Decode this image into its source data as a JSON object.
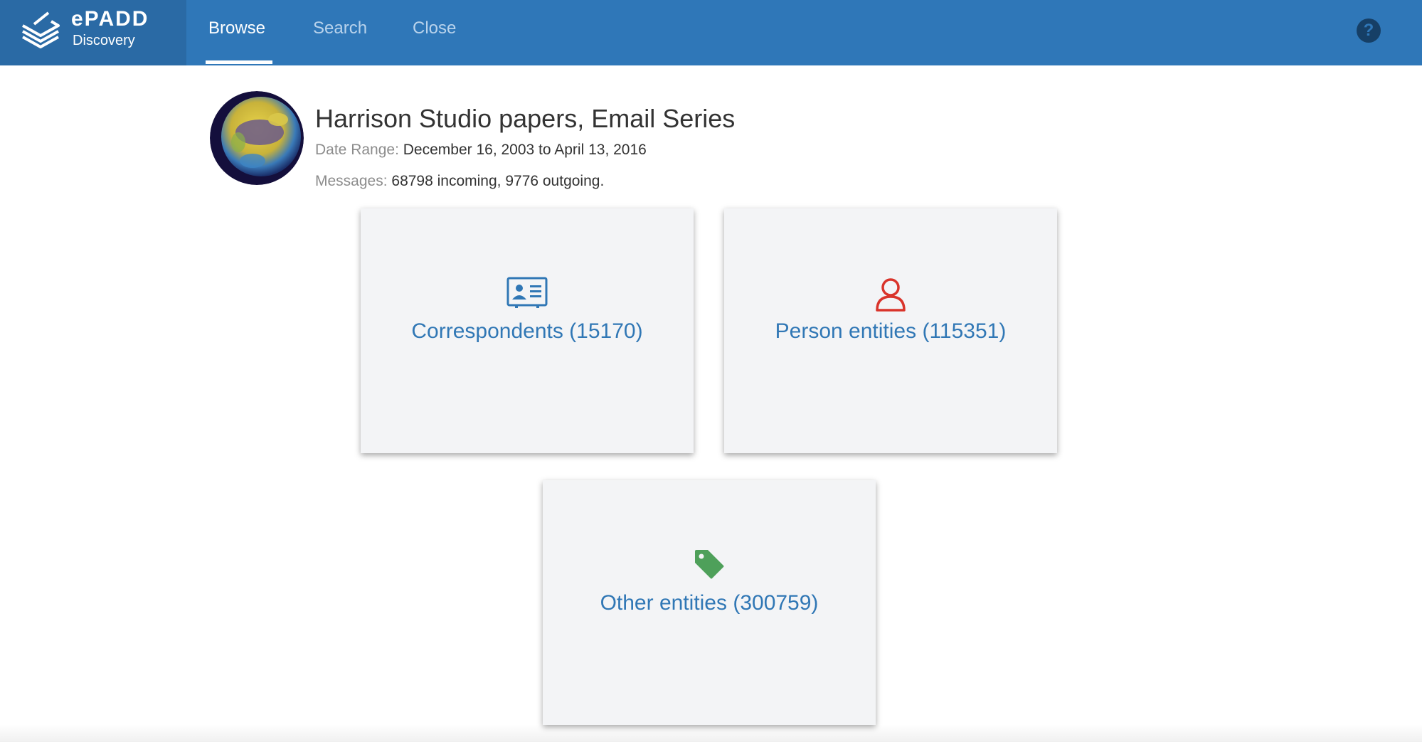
{
  "brand": {
    "name": "ePADD",
    "subtitle": "Discovery"
  },
  "nav": {
    "items": [
      {
        "label": "Browse",
        "active": true
      },
      {
        "label": "Search",
        "active": false
      },
      {
        "label": "Close",
        "active": false
      }
    ],
    "help_icon": "question-circle-icon",
    "help_label": "?"
  },
  "collection": {
    "title": "Harrison Studio papers, Email Series",
    "date_range_label": "Date Range:",
    "date_range_value": "December 16, 2003 to April 13, 2016",
    "messages_label": "Messages:",
    "messages_value": "68798 incoming, 9776 outgoing."
  },
  "cards": [
    {
      "label": "Correspondents (15170)",
      "icon": "contact-card-icon",
      "color": "#3077b5"
    },
    {
      "label": "Person entities (115351)",
      "icon": "person-icon",
      "color": "#d9342b"
    },
    {
      "label": "Other entities (300759)",
      "icon": "tag-icon",
      "color": "#4ea05a"
    }
  ],
  "colors": {
    "navbar": "#2f77b8",
    "brand_bg": "#2a6aa5",
    "link": "#3077b5"
  }
}
